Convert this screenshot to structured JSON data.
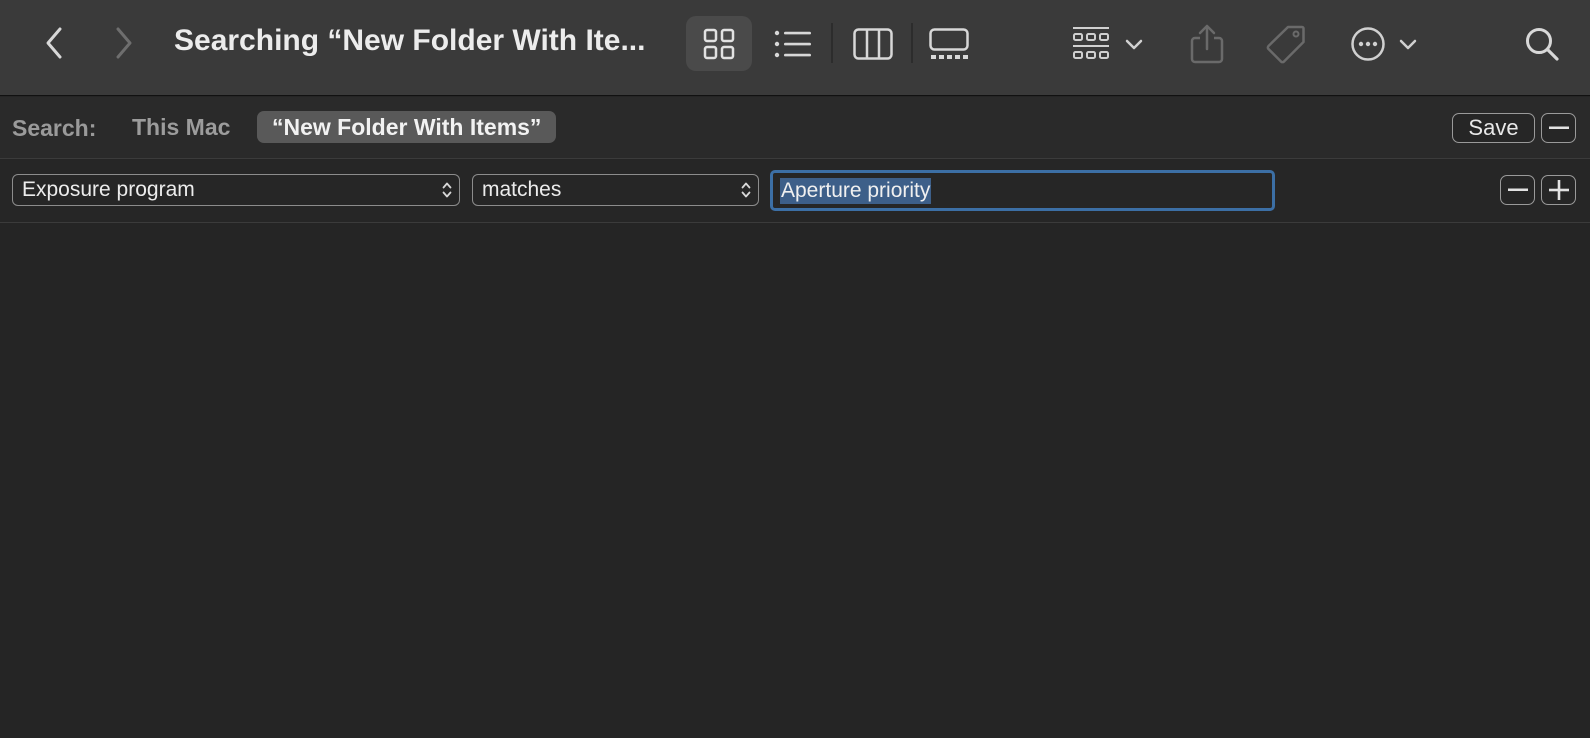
{
  "window": {
    "title": "Searching “New Folder With Ite..."
  },
  "toolbar": {
    "back_icon": "chevron-left-icon",
    "forward_icon": "chevron-right-icon",
    "views": [
      "icon-view",
      "list-view",
      "column-view",
      "gallery-view"
    ],
    "selected_view": "icon-view",
    "group_icon": "group-by-icon",
    "share_icon": "share-icon",
    "tag_icon": "tag-icon",
    "more_icon": "ellipsis-circle-icon",
    "search_icon": "search-icon"
  },
  "scope": {
    "label": "Search:",
    "this_mac": "This Mac",
    "folder": "“New Folder With Items”",
    "save_label": "Save"
  },
  "rule": {
    "attribute": "Exposure program",
    "operator": "matches",
    "value": "Aperture priority"
  },
  "colors": {
    "toolbar_bg": "#3a3a3a",
    "content_bg": "#252525",
    "focus_ring": "#3c6fa5",
    "selection": "#3d5f89"
  }
}
